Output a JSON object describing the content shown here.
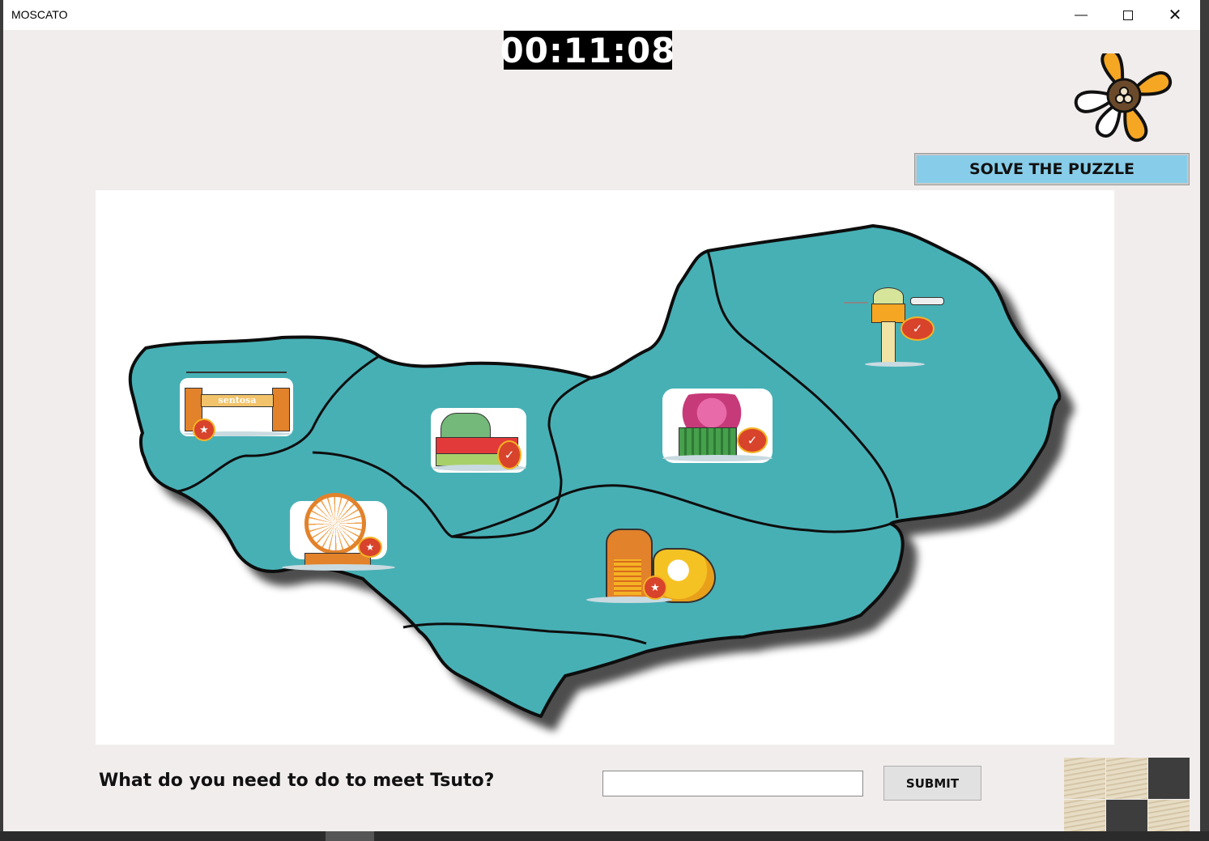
{
  "window": {
    "title": "MOSCATO"
  },
  "timer": {
    "text": "00:11:08"
  },
  "solve_button": {
    "label": "SOLVE THE PUZZLE"
  },
  "landmarks": {
    "sentosa": {
      "label": "sentosa"
    }
  },
  "question": {
    "text": "What do you need to do to meet Tsuto?"
  },
  "answer_field": {
    "value": "",
    "placeholder": ""
  },
  "submit_button": {
    "label": "SUBMIT"
  },
  "colors": {
    "map_fill": "#47b0b5",
    "solve_button": "#87cde9",
    "timer_bg": "#000000",
    "logo_orange": "#f5a623"
  },
  "icons": [
    "minimize-icon",
    "maximize-icon",
    "close-icon",
    "flower-logo-icon",
    "check-badge-icon",
    "star-badge-icon"
  ]
}
